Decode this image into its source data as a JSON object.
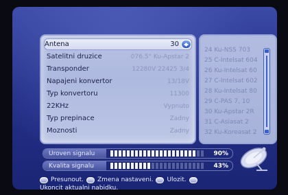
{
  "settings": {
    "rows": [
      {
        "label": "Antena",
        "value": "30"
      },
      {
        "label": "Satelitni druzice",
        "value": "076.5° Ku-Apstar 2"
      },
      {
        "label": "Transponder",
        "value": "12280V 22425 3/4"
      },
      {
        "label": "Napajeni konvertor",
        "value": "13/18V"
      },
      {
        "label": "Typ konvertoru",
        "value": "11300"
      },
      {
        "label": "22KHz",
        "value": "Vypnuto"
      },
      {
        "label": "Typ prepinace",
        "value": "Zadny"
      },
      {
        "label": "Moznosti",
        "value": "Zadny"
      }
    ]
  },
  "satellite_list": {
    "items": [
      "24 Ku-NSS 703",
      "25 C-Intelsat 604",
      "26 Ku-Intelsat 60",
      "27 C-Intelsat 602",
      "28 Ku-Intelsat 80",
      "29 C-PAS 7, 10",
      "30 Ku-Apstar 2R",
      "31 C-Asiasat 2",
      "32 Ku-Koreasat 2"
    ]
  },
  "signal": {
    "level_label": "Uroven signalu",
    "level_pct_text": "90%",
    "level_fraction": 0.9,
    "quality_label": "Kvalita signalu",
    "quality_pct_text": "43%",
    "quality_fraction": 0.43
  },
  "help": {
    "move": "Presunout.",
    "change": "Zmena nastaveni.",
    "save": "Ulozit.",
    "exit": "Ukoncit aktualni nabidku."
  },
  "icons": {
    "selector": "left-right-arrow-icon",
    "nav": "dpad-icon",
    "change": "left-right-button-icon",
    "ok": "ok-button-icon",
    "exit": "exit-button-icon",
    "dish": "satellite-dish-icon"
  },
  "colors": {
    "background": "#26328a",
    "panel": "#b8c1e3",
    "selected_row": "#e9edf9",
    "accent": "#2a55c4"
  }
}
